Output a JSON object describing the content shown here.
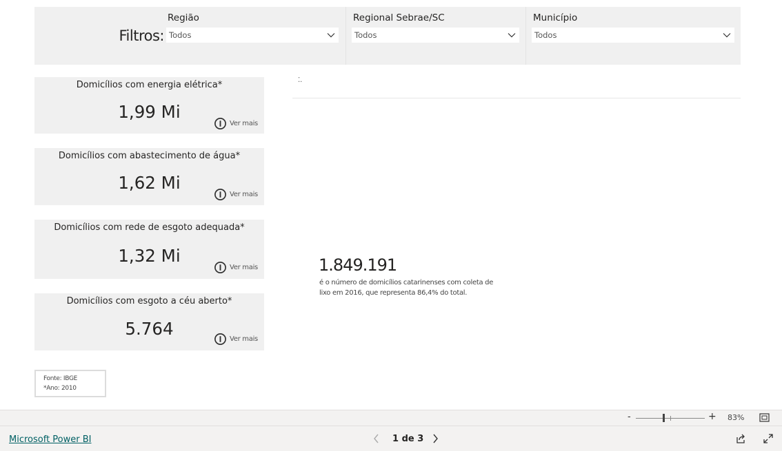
{
  "filters": {
    "title": "Filtros:",
    "regiao": {
      "label": "Região",
      "value": "Todos"
    },
    "regional": {
      "label": "Regional Sebrae/SC",
      "value": "Todos"
    },
    "municipio": {
      "label": "Município",
      "value": "Todos"
    }
  },
  "cards": [
    {
      "title": "Domicílios com energia elétrica*",
      "value": "1,99 Mi",
      "more": "Ver mais"
    },
    {
      "title": "Domicílios com abastecimento de água*",
      "value": "1,62 Mi",
      "more": "Ver mais"
    },
    {
      "title": "Domicílios com rede de esgoto adequada*",
      "value": "1,32 Mi",
      "more": "Ver mais"
    },
    {
      "title": "Domicílios com esgoto a céu aberto*",
      "value": "5.764",
      "more": "Ver mais"
    }
  ],
  "source": {
    "line1": "Fonte: IBGE",
    "line2": "*Ano: 2010"
  },
  "highlight": {
    "mark": "⁚.",
    "number": "1.849.191",
    "description": "é o número de domicílios catarinenses com coleta de lixo em 2016, que representa 86,4% do total."
  },
  "zoom": {
    "minus": "-",
    "plus": "+",
    "level": "83%"
  },
  "footer": {
    "brand": "Microsoft Power BI",
    "page": "1 de 3"
  },
  "icons": {
    "dropdown": "chevron-down-icon",
    "info": "info-icon",
    "fit": "fit-to-page-icon",
    "share": "share-icon",
    "expand": "fullscreen-icon"
  }
}
